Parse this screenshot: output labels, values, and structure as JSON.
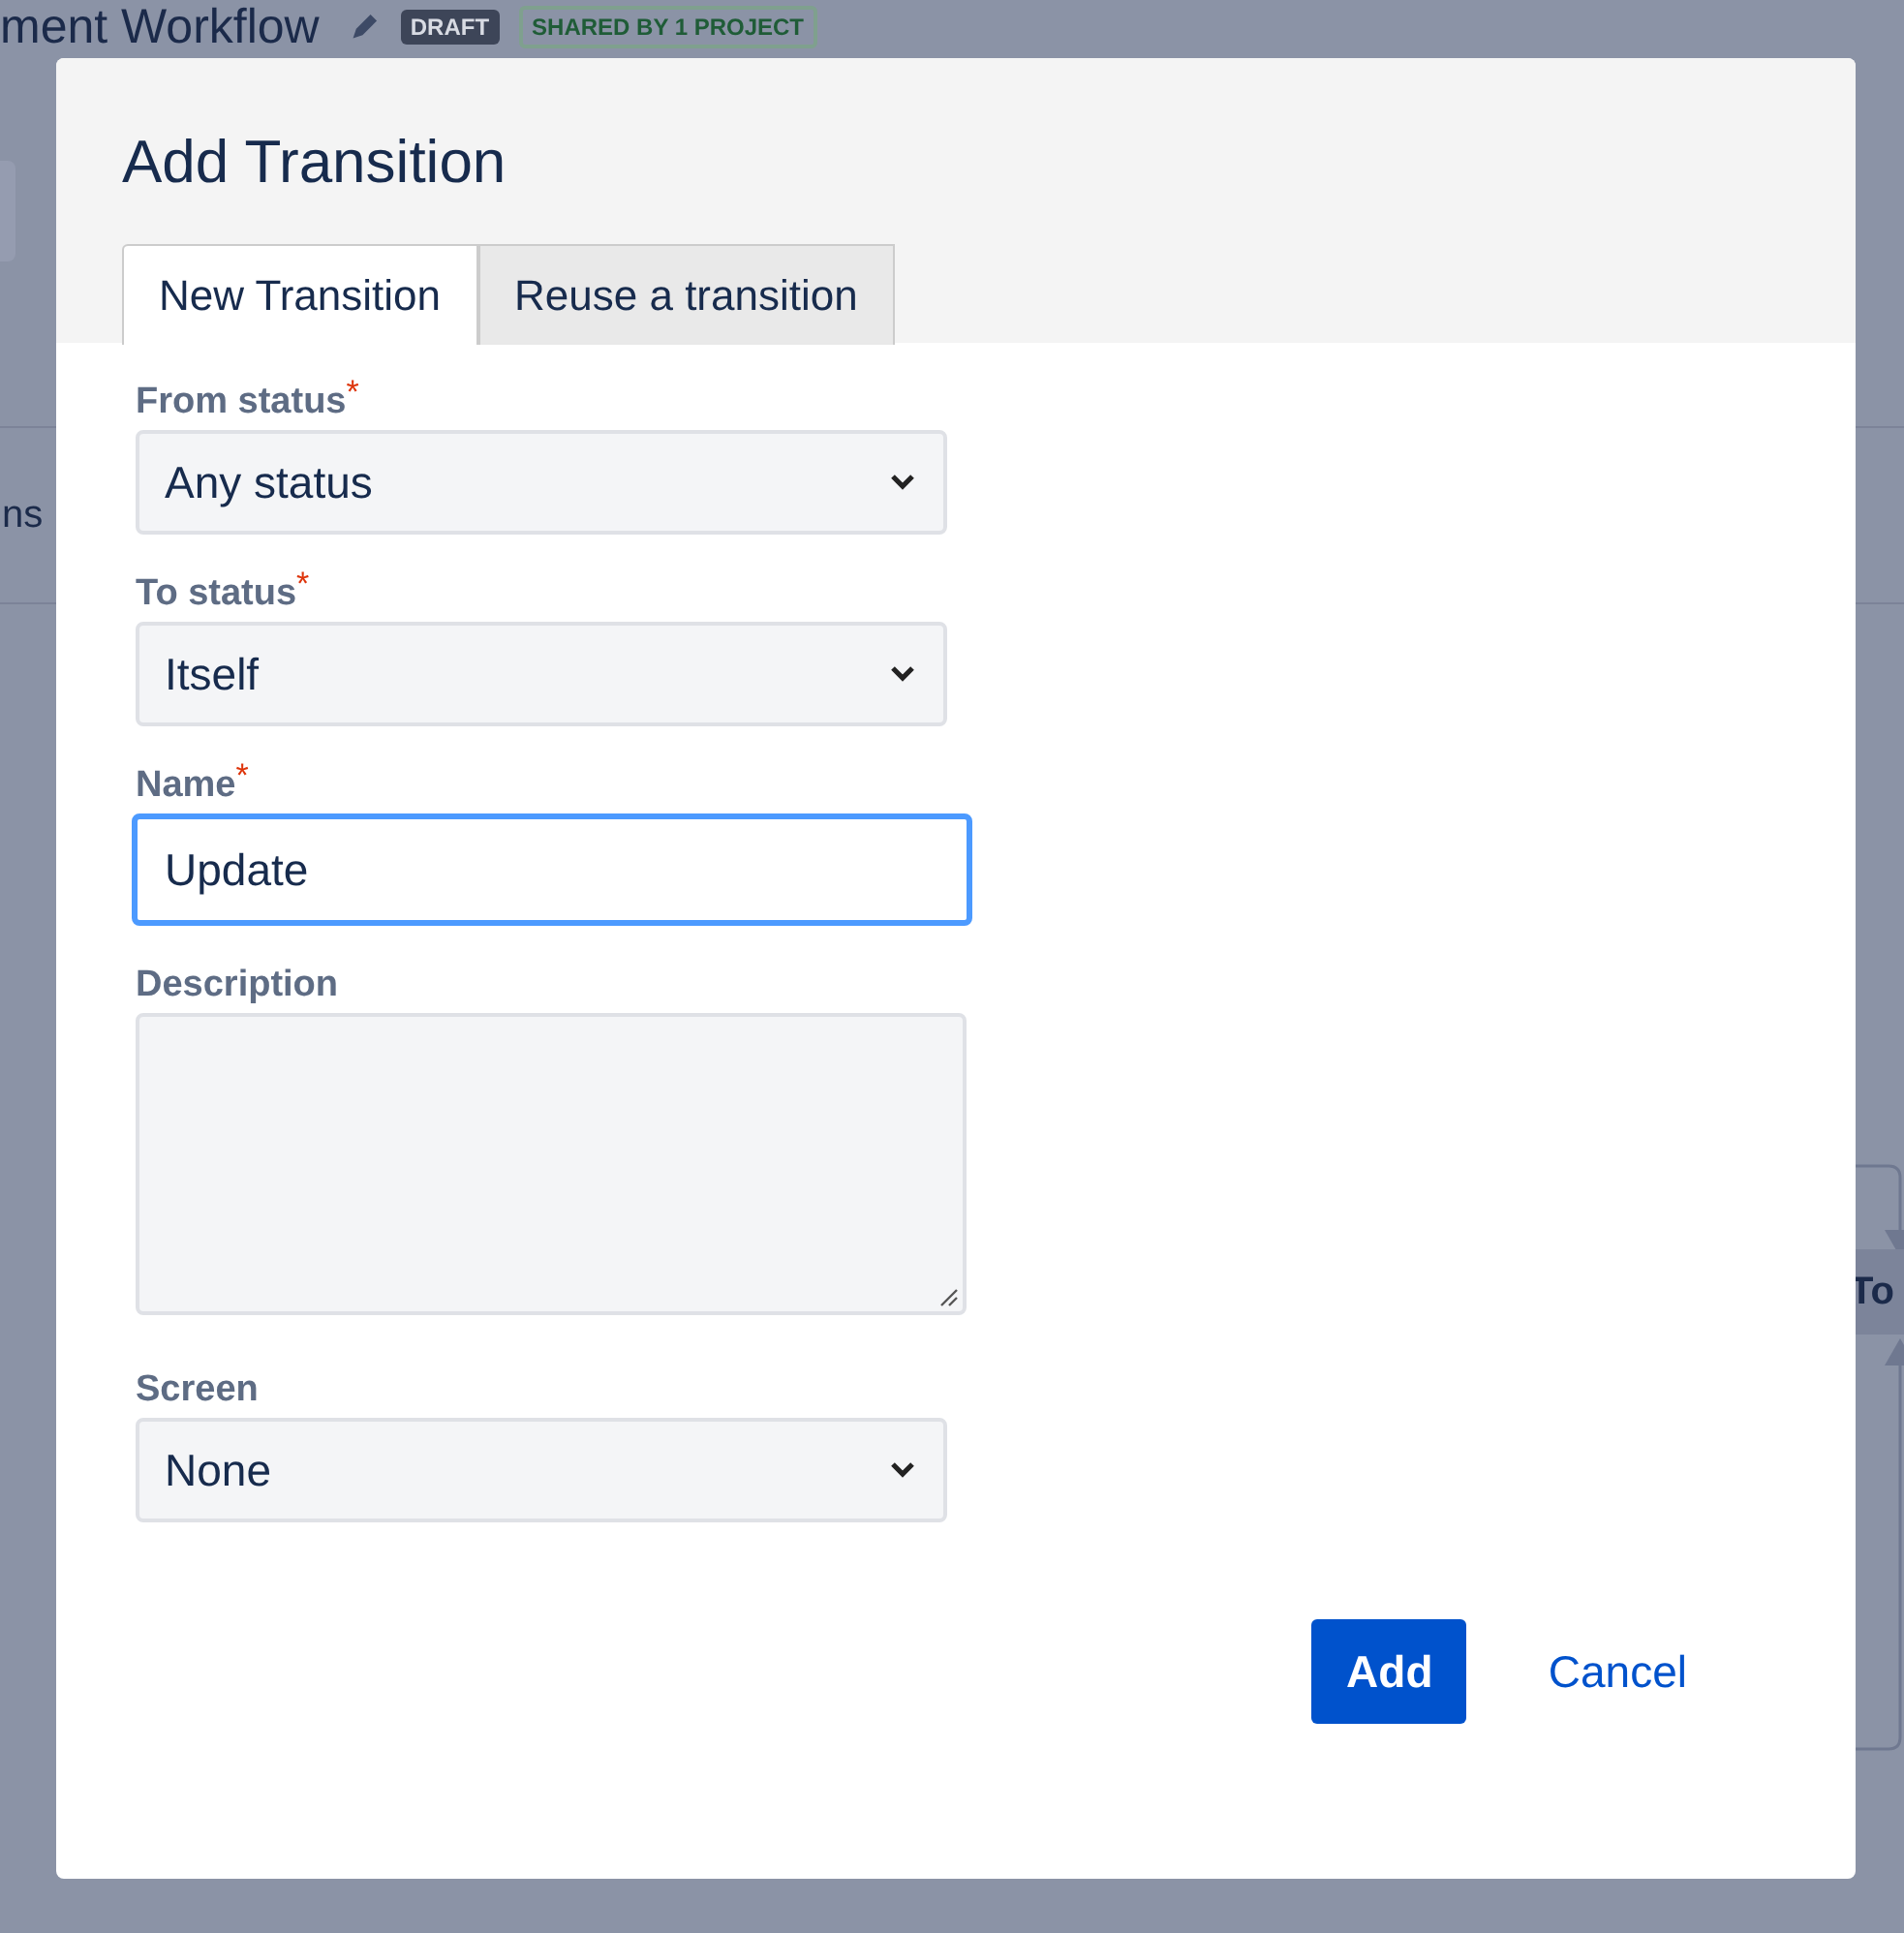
{
  "background": {
    "title": "ment Workflow",
    "badges": [
      {
        "label": "DRAFT",
        "kind": "dark"
      },
      {
        "label": "SHARED BY 1 PROJECT",
        "kind": "outline"
      }
    ],
    "side_text": "ns",
    "node_text": "To"
  },
  "dialog": {
    "title": "Add Transition",
    "tabs": [
      {
        "label": "New Transition",
        "selected": true
      },
      {
        "label": "Reuse a transition",
        "selected": false
      }
    ],
    "fields": [
      {
        "kind": "select",
        "label": "From status",
        "required_mark": "*",
        "value": "Any status",
        "focused": false
      },
      {
        "kind": "select",
        "label": "To status",
        "required_mark": "*",
        "value": "Itself",
        "focused": false
      },
      {
        "kind": "text",
        "label": "Name",
        "required_mark": "*",
        "value": "Update",
        "focused": true
      },
      {
        "kind": "textarea",
        "label": "Description",
        "focused": false
      },
      {
        "kind": "select",
        "label": "Screen",
        "value": "None",
        "focused": false
      }
    ],
    "buttons": [
      {
        "label": "Add",
        "kind": "primary"
      },
      {
        "label": "Cancel",
        "kind": "link"
      }
    ]
  }
}
